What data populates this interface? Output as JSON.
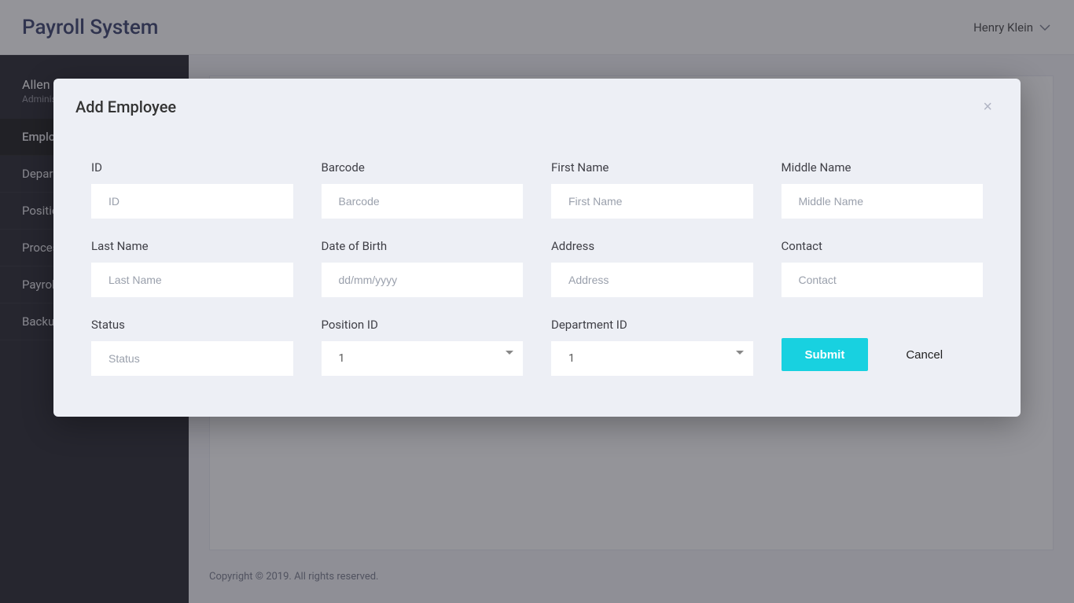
{
  "brand": "Payroll System",
  "topbar": {
    "username": "Henry Klein"
  },
  "sidebar": {
    "user": {
      "name": "Allen Moreno",
      "role": "Administrator"
    },
    "items": [
      {
        "label": "Employees"
      },
      {
        "label": "Departments"
      },
      {
        "label": "Positions"
      },
      {
        "label": "Process"
      },
      {
        "label": "Payroll"
      },
      {
        "label": "Backup"
      }
    ]
  },
  "modal": {
    "title": "Add Employee",
    "close": "×",
    "labels": {
      "id": "ID",
      "barcode": "Barcode",
      "first_name": "First Name",
      "middle_name": "Middle Name",
      "last_name": "Last Name",
      "dob": "Date of Birth",
      "address": "Address",
      "contact": "Contact",
      "status": "Status",
      "position_id": "Position ID",
      "department_id": "Department ID"
    },
    "placeholders": {
      "id": "ID",
      "barcode": "Barcode",
      "first_name": "First Name",
      "middle_name": "Middle Name",
      "last_name": "Last Name",
      "dob": "dd/mm/yyyy",
      "address": "Address",
      "contact": "Contact",
      "status": "Status"
    },
    "selects": {
      "position_id": "1",
      "department_id": "1"
    },
    "buttons": {
      "submit": "Submit",
      "cancel": "Cancel"
    }
  },
  "footer": {
    "text": "Copyright © 2019. All rights reserved."
  }
}
